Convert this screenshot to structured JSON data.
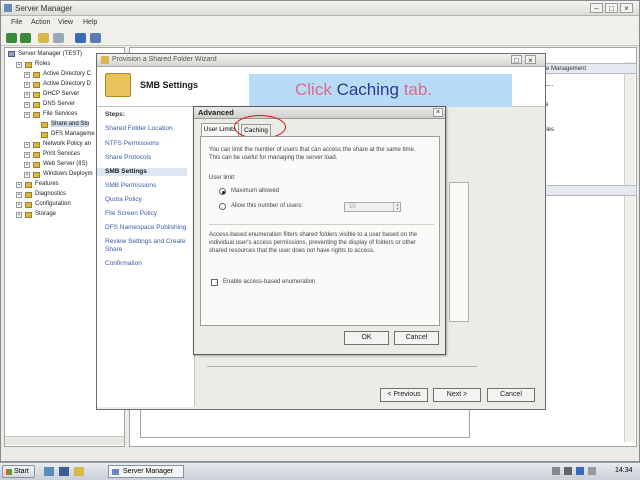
{
  "main_window": {
    "title": "Server Manager",
    "menu": [
      "File",
      "Action",
      "View",
      "Help"
    ]
  },
  "tree": {
    "root": "Server Manager (TEST)",
    "items": [
      {
        "label": "Roles",
        "indent": 1
      },
      {
        "label": "Active Directory C",
        "indent": 2
      },
      {
        "label": "Active Directory D",
        "indent": 2
      },
      {
        "label": "DHCP Server",
        "indent": 2
      },
      {
        "label": "DNS Server",
        "indent": 2
      },
      {
        "label": "File Services",
        "indent": 2
      },
      {
        "label": "Share and Sto",
        "indent": 3
      },
      {
        "label": "DFS Manageme",
        "indent": 3
      },
      {
        "label": "Network Policy an",
        "indent": 2
      },
      {
        "label": "Print Services",
        "indent": 2
      },
      {
        "label": "Web Server (IIS)",
        "indent": 2
      },
      {
        "label": "Windows Deploym",
        "indent": 2
      },
      {
        "label": "Features",
        "indent": 1
      },
      {
        "label": "Diagnostics",
        "indent": 1
      },
      {
        "label": "Configuration",
        "indent": 1
      },
      {
        "label": "Storage",
        "indent": 1
      }
    ]
  },
  "right_pane": {
    "actions_header": "e Management",
    "actions_lines": [
      "L...",
      "e",
      "iles",
      ""
    ]
  },
  "wizard": {
    "title": "Provision a Shared Folder Wizard",
    "heading": "SMB Settings",
    "steps_header": "Steps:",
    "steps": [
      "Shared Folder Location",
      "NTFS Permissions",
      "Share Protocols",
      "SMB Settings",
      "SMB Permissions",
      "Quota Policy",
      "File Screen Policy",
      "DFS Namespace Publishing",
      "Review Settings and Create Share",
      "Confirmation"
    ],
    "buttons": {
      "previous": "< Previous",
      "next": "Next >",
      "cancel": "Cancel"
    }
  },
  "instruction": {
    "click": "Click",
    "caching": "Caching",
    "tab": "tab."
  },
  "advanced": {
    "title": "Advanced",
    "tabs": [
      "User Limits",
      "Caching"
    ],
    "description": "You can limit the number of users that can access the share at the same time. This can be useful for managing the server load.",
    "user_limit_label": "User limit:",
    "opt_max": "Maximum allowed",
    "opt_allow": "Allow this number of users:",
    "users_value": "10",
    "abe_text": "Access-based enumeration filters shared folders visible to a user based on the individual user's access permissions, preventing the display of folders or other shared resources that the user does not have rights to access.",
    "abe_checkbox": "Enable access-based enumeration",
    "ok": "OK",
    "cancel": "Cancel"
  },
  "taskbar": {
    "start": "Start",
    "task": "Server Manager",
    "clock": "14:34"
  },
  "colors": {
    "click": "#e06a88",
    "caching": "#2a3a9a",
    "banner": "#b8dbf8",
    "highlight_circle": "#d01818"
  }
}
